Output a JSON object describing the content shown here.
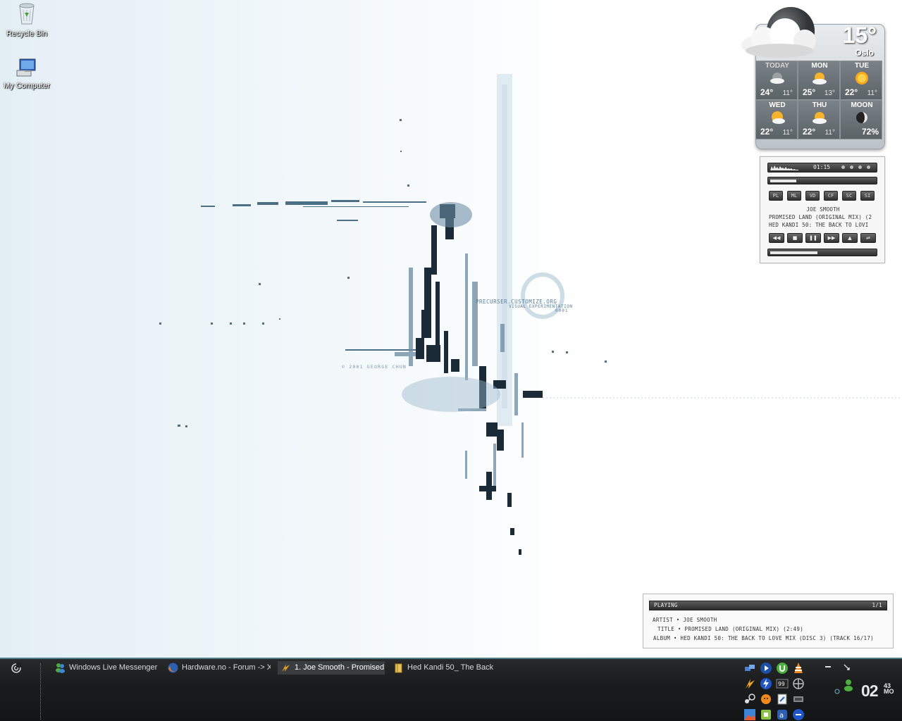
{
  "desktop": {
    "icons": [
      {
        "label": "Recycle Bin",
        "icon": "recycle-bin-icon"
      },
      {
        "label": "My Computer",
        "icon": "my-computer-icon"
      }
    ],
    "wallpaper_text": {
      "site": "PRECURSER.CUSTOMIZE.ORG",
      "tagline": "VISUAL EXPERIMENTATION",
      "number": "0001",
      "copyright": "© 2001 GEORGE CHUN"
    }
  },
  "weather": {
    "current_temp": "15°",
    "city": "Oslo",
    "days": [
      {
        "label": "TODAY",
        "hi": "24°",
        "lo": "11°",
        "icon": "partly-cloudy-night-icon"
      },
      {
        "label": "MON",
        "hi": "25°",
        "lo": "13°",
        "icon": "partly-sunny-icon"
      },
      {
        "label": "TUE",
        "hi": "22°",
        "lo": "11°",
        "icon": "sunny-icon"
      },
      {
        "label": "WED",
        "hi": "22°",
        "lo": "11°",
        "icon": "partly-sunny-icon"
      },
      {
        "label": "THU",
        "hi": "22°",
        "lo": "11°",
        "icon": "partly-sunny-icon"
      }
    ],
    "moon": {
      "label": "MOON",
      "value": "72%",
      "icon": "moon-phase-icon"
    }
  },
  "winamp": {
    "time": "01:15",
    "buttons": [
      "PL",
      "ML",
      "VD",
      "CF",
      "SC",
      "SI"
    ],
    "artist": "JOE SMOOTH",
    "title": "PROMISED LAND (ORIGINAL MIX) (2",
    "album": "HED KANDI 50: THE BACK TO LOVI",
    "controls": [
      "previous-icon",
      "stop-icon",
      "pause-icon",
      "next-icon",
      "eject-icon",
      "shuffle-icon"
    ],
    "seek_fraction": 0.25,
    "volume_fraction": 0.45
  },
  "now_playing": {
    "header": "PLAYING",
    "count": "1/1",
    "artist_line": "ARTIST • JOE SMOOTH",
    "title_line": "TITLE • PROMISED LAND (ORIGINAL MIX) (2:49)",
    "album_line": "ALBUM • HED KANDI 50: THE BACK TO LOVE MIX (DISC 3) (TRACK 16/17)"
  },
  "taskbar": {
    "tasks": [
      {
        "label": "Windows Live Messenger",
        "icon": "messenger-icon",
        "active": false
      },
      {
        "label": "Hardware.no - Forum -> X...",
        "icon": "firefox-icon",
        "active": false
      },
      {
        "label": "1. Joe Smooth - Promised...",
        "icon": "winamp-icon",
        "active": true
      },
      {
        "label": "Hed Kandi 50_ The Back ...",
        "icon": "folder-icon",
        "active": false
      }
    ],
    "clock": {
      "time": "02",
      "minutes": "43",
      "ampm": "MO"
    },
    "tray_icons": [
      "network-icon",
      "media-player-icon",
      "utorrent-icon",
      "vlc-icon",
      "winamp-tray-icon",
      "daemon-tools-icon",
      "temperature-icon",
      "fan-icon",
      "steam-icon",
      "fox-icon",
      "clipboard-icon",
      "tool-icon",
      "photo-icon",
      "android-icon",
      "a-icon",
      "shield-icon"
    ]
  }
}
